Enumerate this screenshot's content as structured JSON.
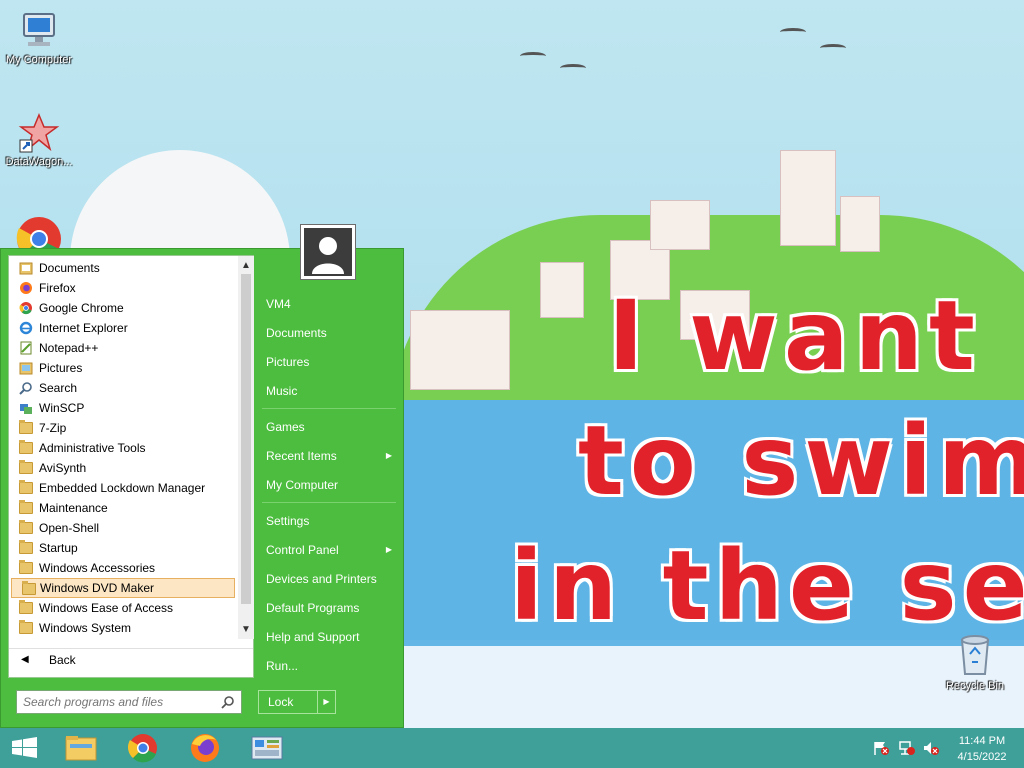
{
  "desktop": {
    "icons": [
      {
        "label": "My Computer",
        "icon": "my-computer-icon"
      },
      {
        "label": "DataWagon...",
        "icon": "datawagon-shortcut-icon"
      },
      {
        "label": "Recycle Bin",
        "icon": "recycle-bin-icon"
      }
    ]
  },
  "start_menu": {
    "programs": [
      {
        "label": "Documents",
        "icon": "documents-icon"
      },
      {
        "label": "Firefox",
        "icon": "firefox-icon"
      },
      {
        "label": "Google Chrome",
        "icon": "chrome-icon"
      },
      {
        "label": "Internet Explorer",
        "icon": "internet-explorer-icon"
      },
      {
        "label": "Notepad++",
        "icon": "notepadpp-icon"
      },
      {
        "label": "Pictures",
        "icon": "pictures-icon"
      },
      {
        "label": "Search",
        "icon": "search-icon"
      },
      {
        "label": "WinSCP",
        "icon": "winscp-icon"
      },
      {
        "label": "7-Zip",
        "icon": "folder-icon"
      },
      {
        "label": "Administrative Tools",
        "icon": "folder-icon"
      },
      {
        "label": "AviSynth",
        "icon": "folder-icon"
      },
      {
        "label": "Embedded Lockdown Manager",
        "icon": "folder-icon"
      },
      {
        "label": "Maintenance",
        "icon": "folder-icon"
      },
      {
        "label": "Open-Shell",
        "icon": "folder-icon"
      },
      {
        "label": "Startup",
        "icon": "folder-icon"
      },
      {
        "label": "Windows Accessories",
        "icon": "folder-icon"
      },
      {
        "label": "Windows DVD Maker",
        "icon": "folder-icon",
        "selected": true
      },
      {
        "label": "Windows Ease of Access",
        "icon": "folder-icon"
      },
      {
        "label": "Windows System",
        "icon": "folder-icon"
      }
    ],
    "back_label": "Back",
    "search_placeholder": "Search programs and files",
    "right_items": [
      {
        "label": "VM4"
      },
      {
        "label": "Documents"
      },
      {
        "label": "Pictures"
      },
      {
        "label": "Music"
      },
      {
        "label": "Games"
      },
      {
        "label": "Recent Items",
        "submenu": true
      },
      {
        "label": "My Computer"
      },
      {
        "label": "Settings"
      },
      {
        "label": "Control Panel",
        "submenu": true
      },
      {
        "label": "Devices and Printers"
      },
      {
        "label": "Default Programs"
      },
      {
        "label": "Help and Support"
      },
      {
        "label": "Run..."
      }
    ],
    "lock_label": "Lock"
  },
  "wallpaper_text": [
    "I want",
    "to swim",
    "in the se"
  ],
  "taskbar": {
    "buttons": [
      "start-icon",
      "file-explorer-icon",
      "chrome-icon",
      "firefox-icon",
      "control-panel-icon"
    ],
    "time": "11:44 PM",
    "date": "4/15/2022"
  },
  "colors": {
    "start_menu_green": "#4cbd3e",
    "taskbar_teal": "#3fa09a",
    "selection": "#fde6c3"
  }
}
